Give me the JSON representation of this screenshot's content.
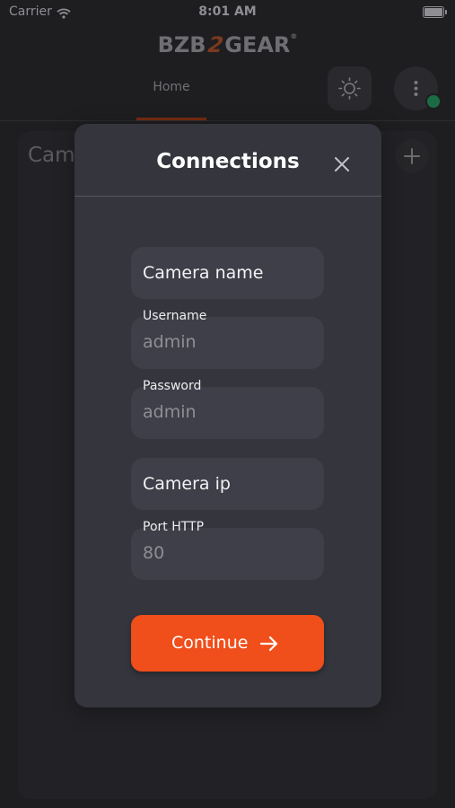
{
  "status_bar": {
    "carrier": "Carrier",
    "time": "8:01 AM"
  },
  "brand": {
    "left": "BZB",
    "mid": "2",
    "right": "GEAR",
    "reg": "®"
  },
  "nav": {
    "home_tab": "Home"
  },
  "background": {
    "panel_title": "Cam"
  },
  "modal": {
    "title": "Connections",
    "camera_name_placeholder": "Camera name",
    "username_label": "Username",
    "username_value": "admin",
    "password_label": "Password",
    "password_value": "admin",
    "camera_ip_placeholder": "Camera ip",
    "port_label": "Port HTTP",
    "port_value": "80",
    "continue_label": "Continue"
  },
  "colors": {
    "accent": "#f04e1a",
    "status_online": "#1b6b43",
    "modal_bg": "#34353d"
  },
  "icons": [
    "wifi-icon",
    "battery-icon",
    "sun-icon",
    "more-vertical-icon",
    "plus-icon",
    "close-icon",
    "arrow-right-icon"
  ]
}
